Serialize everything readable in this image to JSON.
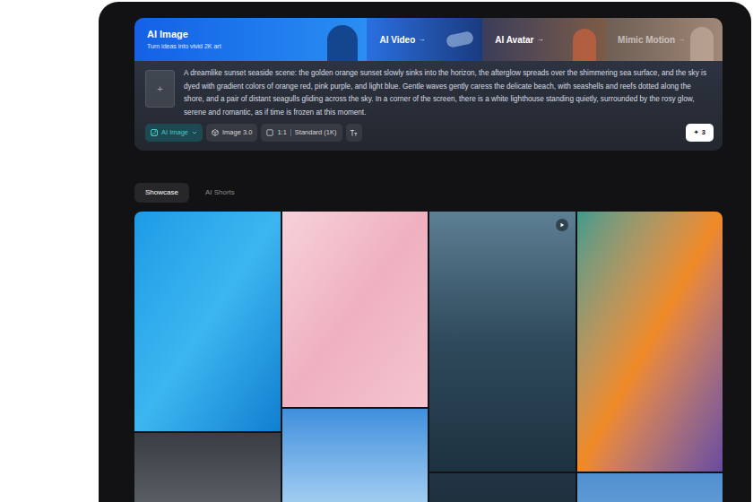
{
  "banner": {
    "tabs": [
      {
        "label": "AI Image",
        "subtitle": "Turn ideas into vivid 2K art",
        "arrow": "",
        "selected": true
      },
      {
        "label": "AI Video",
        "subtitle": "",
        "arrow": "→",
        "selected": false
      },
      {
        "label": "AI Avatar",
        "subtitle": "",
        "arrow": "→",
        "selected": false
      },
      {
        "label": "Mimic Motion",
        "subtitle": "",
        "arrow": "→",
        "selected": false
      }
    ]
  },
  "upload": {
    "icon": "+"
  },
  "prompt": {
    "text": "A dreamlike sunset seaside scene: the golden orange sunset slowly sinks into the horizon, the afterglow spreads over the shimmering sea surface, and the sky is dyed with gradient colors of orange red, pink purple, and light blue. Gentle waves gently caress the delicate beach, with seashells and reefs dotted along the shore, and a pair of distant seagulls gliding across the sky. In a corner of the screen, there is a white lighthouse standing quietly, surrounded by the rosy glow, serene and romantic, as if time is frozen at this moment."
  },
  "toolbar": {
    "mode": {
      "label": "AI Image",
      "selected": true
    },
    "model": "Image 3.0",
    "ratio": "1:1",
    "quality": "Standard (1K)"
  },
  "generate": {
    "icon": "✦",
    "cost": "3"
  },
  "tabs": [
    {
      "label": "Showcase",
      "selected": true
    },
    {
      "label": "AI Shorts",
      "selected": false
    }
  ],
  "gallery": {
    "columns": [
      [
        {
          "kind": "image"
        },
        {
          "kind": "image"
        }
      ],
      [
        {
          "kind": "image"
        },
        {
          "kind": "image"
        }
      ],
      [
        {
          "kind": "video"
        },
        {
          "kind": "image"
        }
      ],
      [
        {
          "kind": "image"
        },
        {
          "kind": "image"
        }
      ]
    ]
  }
}
